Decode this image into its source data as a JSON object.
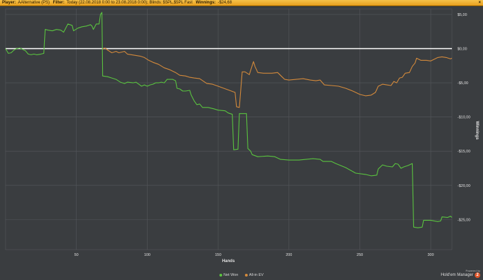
{
  "header": {
    "player_label": "Player:",
    "player_value": "AAlternative (PS)",
    "filter_label": "Filter:",
    "filter_value": "Today (22.08.2018 0:00 to 23.08.2018 0:00); Blinds: $5PL,$5PL Fast",
    "winnings_label": "Winnings:",
    "winnings_value": "-$24,68",
    "close_glyph": "×"
  },
  "brand": {
    "powered_by": "Powered by",
    "name": "Hold'em Manager",
    "version": "2"
  },
  "colors": {
    "net_won": "#5ac43f",
    "allin_ev": "#d48a3b",
    "zero_line": "#ffffff",
    "grid": "#55585c",
    "background": "#3a3d40"
  },
  "chart_data": {
    "type": "line",
    "xlabel": "Hands",
    "ylabel": "Winnings",
    "xlim": [
      0,
      310
    ],
    "ylim": [
      -30,
      5
    ],
    "x_ticks": [
      50,
      100,
      150,
      200,
      250,
      300
    ],
    "x_tick_labels": [
      "50",
      "100",
      "150",
      "200",
      "250",
      "300"
    ],
    "y_ticks": [
      5,
      0,
      -5,
      -10,
      -15,
      -20,
      -25
    ],
    "y_tick_labels": [
      "$5,00",
      "$0,00",
      "-$5,00",
      "-$10,00",
      "-$15,00",
      "-$20,00",
      "-$25,00"
    ],
    "grid": true,
    "legend": "bottom-center",
    "series": [
      {
        "name": "Net Won",
        "color": "#5ac43f",
        "points": [
          [
            0,
            0
          ],
          [
            2,
            -0.7
          ],
          [
            4,
            -0.6
          ],
          [
            6,
            -0.2
          ],
          [
            8,
            0
          ],
          [
            10,
            0.1
          ],
          [
            12,
            -0.1
          ],
          [
            14,
            -0.3
          ],
          [
            16,
            -0.8
          ],
          [
            18,
            -0.9
          ],
          [
            20,
            -0.8
          ],
          [
            22,
            -0.9
          ],
          [
            25,
            -0.8
          ],
          [
            27,
            -0.7
          ],
          [
            28,
            2.8
          ],
          [
            30,
            2.7
          ],
          [
            33,
            2.6
          ],
          [
            36,
            2.8
          ],
          [
            39,
            2.7
          ],
          [
            41,
            2.4
          ],
          [
            44,
            3.6
          ],
          [
            47,
            3.4
          ],
          [
            48,
            2.6
          ],
          [
            51,
            3.0
          ],
          [
            54,
            3.2
          ],
          [
            57,
            3.3
          ],
          [
            60,
            3.5
          ],
          [
            61,
            3.3
          ],
          [
            62,
            2.8
          ],
          [
            64,
            3.6
          ],
          [
            66,
            3.6
          ],
          [
            67,
            5.0
          ],
          [
            68,
            5.3
          ],
          [
            68.5,
            -4.0
          ],
          [
            72,
            -4.1
          ],
          [
            75,
            -4.3
          ],
          [
            78,
            -4.5
          ],
          [
            81,
            -4.9
          ],
          [
            84,
            -5.1
          ],
          [
            86,
            -4.9
          ],
          [
            90,
            -5.0
          ],
          [
            92,
            -4.9
          ],
          [
            94,
            -5.2
          ],
          [
            96,
            -5.5
          ],
          [
            98,
            -5.3
          ],
          [
            100,
            -5.5
          ],
          [
            102,
            -5.3
          ],
          [
            104,
            -5.2
          ],
          [
            106,
            -5.0
          ],
          [
            108,
            -5.0
          ],
          [
            110,
            -4.9
          ],
          [
            112,
            -5.0
          ],
          [
            114,
            -4.5
          ],
          [
            118,
            -4.5
          ],
          [
            120,
            -4.7
          ],
          [
            121,
            -5.8
          ],
          [
            123,
            -5.9
          ],
          [
            125,
            -6.2
          ],
          [
            127,
            -6.2
          ],
          [
            130,
            -6.1
          ],
          [
            131,
            -6.8
          ],
          [
            133,
            -7.6
          ],
          [
            135,
            -8.2
          ],
          [
            137,
            -8.1
          ],
          [
            139,
            -8.6
          ],
          [
            143,
            -8.6
          ],
          [
            147,
            -8.8
          ],
          [
            150,
            -9.0
          ],
          [
            155,
            -9.1
          ],
          [
            157,
            -9.4
          ],
          [
            160,
            -9.6
          ],
          [
            161,
            -14.8
          ],
          [
            164,
            -14.7
          ],
          [
            165,
            -9.5
          ],
          [
            170,
            -9.5
          ],
          [
            171,
            -14.6
          ],
          [
            173,
            -15.0
          ],
          [
            174,
            -15.5
          ],
          [
            178,
            -15.8
          ],
          [
            185,
            -15.7
          ],
          [
            190,
            -15.8
          ],
          [
            194,
            -16.2
          ],
          [
            200,
            -16.3
          ],
          [
            207,
            -16.3
          ],
          [
            212,
            -16.2
          ],
          [
            217,
            -16.1
          ],
          [
            222,
            -16.2
          ],
          [
            224,
            -16.5
          ],
          [
            230,
            -16.5
          ],
          [
            233,
            -16.8
          ],
          [
            240,
            -17.4
          ],
          [
            247,
            -18.2
          ],
          [
            254,
            -18.4
          ],
          [
            258,
            -18.6
          ],
          [
            262,
            -18.5
          ],
          [
            263,
            -17.6
          ],
          [
            266,
            -17.0
          ],
          [
            269,
            -17.2
          ],
          [
            273,
            -17.3
          ],
          [
            275,
            -16.8
          ],
          [
            277,
            -16.9
          ],
          [
            279,
            -17.5
          ],
          [
            281,
            -17.3
          ],
          [
            284,
            -17.1
          ],
          [
            286,
            -16.9
          ],
          [
            287,
            -16.8
          ],
          [
            288,
            -26.1
          ],
          [
            291,
            -26.2
          ],
          [
            294,
            -26.1
          ],
          [
            295,
            -25.1
          ],
          [
            300,
            -25.1
          ],
          [
            305,
            -25.3
          ],
          [
            307,
            -25.2
          ],
          [
            308,
            -24.6
          ],
          [
            312,
            -24.7
          ],
          [
            314,
            -24.5
          ],
          [
            315,
            -24.7
          ]
        ]
      },
      {
        "name": "All-in EV",
        "color": "#d48a3b",
        "points": [
          [
            68.5,
            -0.1
          ],
          [
            70,
            0.1
          ],
          [
            72,
            -0.2
          ],
          [
            75,
            -0.6
          ],
          [
            78,
            -0.4
          ],
          [
            80,
            -0.6
          ],
          [
            82,
            -0.5
          ],
          [
            84,
            -0.4
          ],
          [
            86,
            -0.8
          ],
          [
            89,
            -0.9
          ],
          [
            92,
            -1.0
          ],
          [
            95,
            -1.1
          ],
          [
            98,
            -1.3
          ],
          [
            101,
            -1.7
          ],
          [
            104,
            -2.0
          ],
          [
            108,
            -2.3
          ],
          [
            112,
            -2.8
          ],
          [
            116,
            -3.1
          ],
          [
            120,
            -3.5
          ],
          [
            123,
            -3.9
          ],
          [
            127,
            -4.0
          ],
          [
            130,
            -4.2
          ],
          [
            133,
            -4.3
          ],
          [
            137,
            -4.4
          ],
          [
            142,
            -5.1
          ],
          [
            146,
            -5.2
          ],
          [
            150,
            -5.5
          ],
          [
            154,
            -5.8
          ],
          [
            158,
            -6.1
          ],
          [
            162,
            -6.4
          ],
          [
            163,
            -8.5
          ],
          [
            165,
            -8.6
          ],
          [
            167,
            -3.4
          ],
          [
            169,
            -3.4
          ],
          [
            172,
            -3.8
          ],
          [
            174,
            -2.5
          ],
          [
            175,
            -1.9
          ],
          [
            176,
            -2.6
          ],
          [
            178,
            -3.5
          ],
          [
            182,
            -3.6
          ],
          [
            188,
            -3.6
          ],
          [
            192,
            -3.5
          ],
          [
            195,
            -4.1
          ],
          [
            197,
            -4.5
          ],
          [
            200,
            -4.6
          ],
          [
            205,
            -4.5
          ],
          [
            210,
            -4.4
          ],
          [
            215,
            -4.6
          ],
          [
            219,
            -4.7
          ],
          [
            222,
            -4.6
          ],
          [
            225,
            -5.3
          ],
          [
            230,
            -5.4
          ],
          [
            235,
            -5.5
          ],
          [
            240,
            -5.8
          ],
          [
            245,
            -6.2
          ],
          [
            250,
            -6.7
          ],
          [
            254,
            -6.9
          ],
          [
            258,
            -6.8
          ],
          [
            261,
            -6.4
          ],
          [
            263,
            -5.5
          ],
          [
            266,
            -5.2
          ],
          [
            269,
            -5.3
          ],
          [
            272,
            -5.4
          ],
          [
            274,
            -4.8
          ],
          [
            276,
            -5.0
          ],
          [
            278,
            -4.3
          ],
          [
            280,
            -4.2
          ],
          [
            282,
            -3.6
          ],
          [
            285,
            -3.5
          ],
          [
            287,
            -2.6
          ],
          [
            289,
            -2.1
          ],
          [
            290,
            -1.4
          ],
          [
            293,
            -1.7
          ],
          [
            297,
            -1.7
          ],
          [
            300,
            -1.8
          ],
          [
            303,
            -1.5
          ],
          [
            305,
            -1.3
          ],
          [
            308,
            -1.2
          ],
          [
            311,
            -1.3
          ],
          [
            314,
            -1.5
          ],
          [
            315,
            -1.4
          ]
        ]
      }
    ]
  }
}
